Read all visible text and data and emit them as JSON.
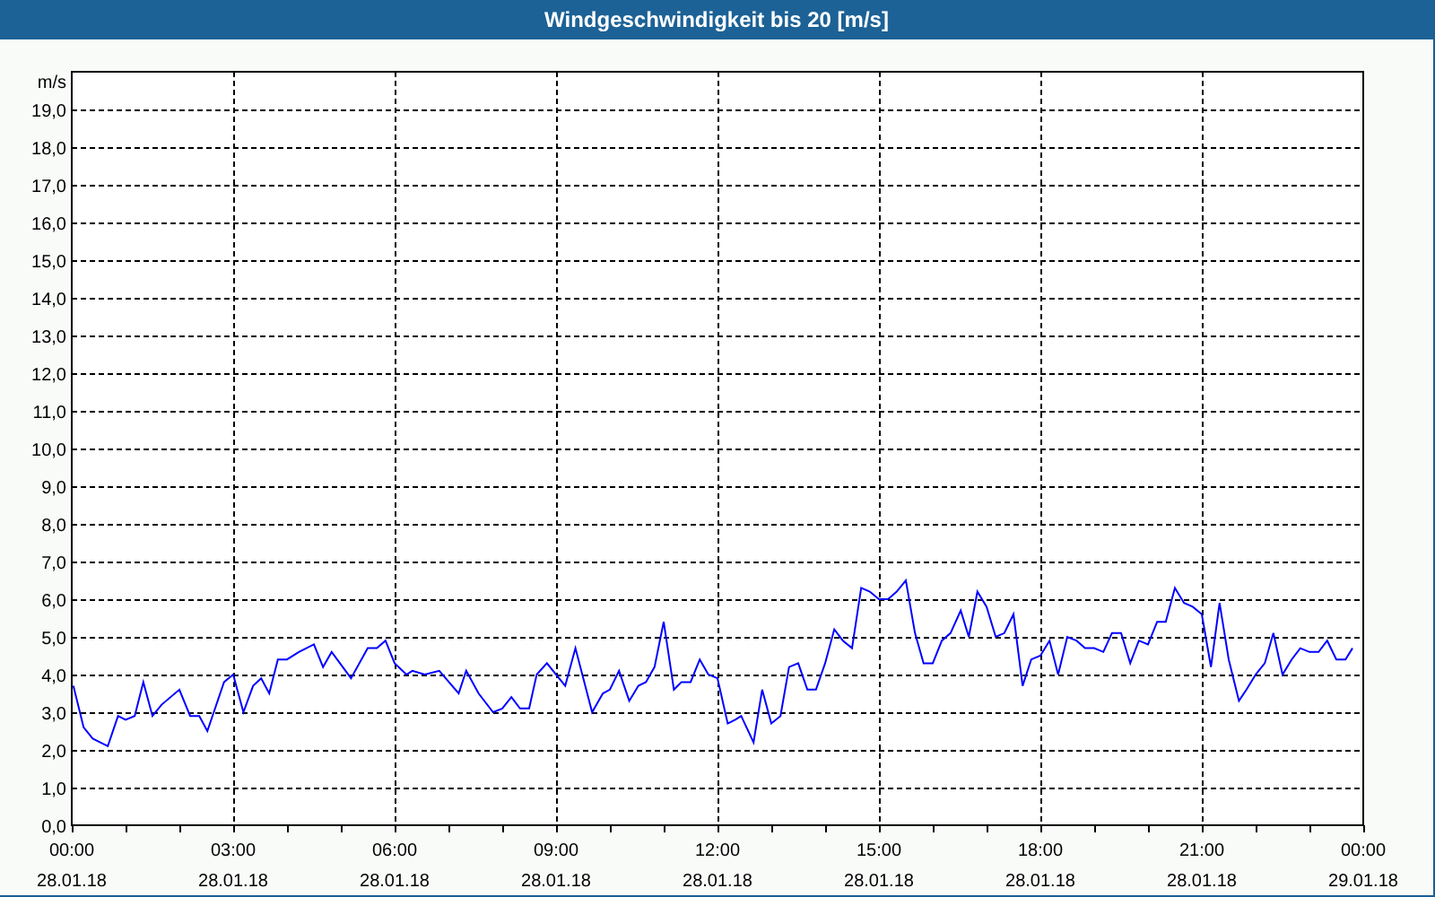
{
  "window": {
    "title": "Windgeschwindigkeit bis 20 [m/s]"
  },
  "chart": {
    "date_labels": [
      "28.01.18",
      "28.01.18",
      "28.01.18",
      "28.01.18",
      "28.01.18",
      "28.01.18",
      "28.01.18",
      "28.01.18",
      "29.01.18"
    ],
    "chart_data": {
      "type": "line",
      "ylabel": "m/s",
      "grid": true,
      "xlim": [
        0,
        24
      ],
      "ylim": [
        0,
        20
      ],
      "xticks": [
        {
          "value": 0,
          "label": "00:00"
        },
        {
          "value": 3,
          "label": "03:00"
        },
        {
          "value": 6,
          "label": "06:00"
        },
        {
          "value": 9,
          "label": "09:00"
        },
        {
          "value": 12,
          "label": "12:00"
        },
        {
          "value": 15,
          "label": "15:00"
        },
        {
          "value": 18,
          "label": "18:00"
        },
        {
          "value": 21,
          "label": "21:00"
        },
        {
          "value": 24,
          "label": "00:00"
        }
      ],
      "yticks": [
        {
          "value": 0,
          "label": "0,0"
        },
        {
          "value": 1,
          "label": "1,0"
        },
        {
          "value": 2,
          "label": "2,0"
        },
        {
          "value": 3,
          "label": "3,0"
        },
        {
          "value": 4,
          "label": "4,0"
        },
        {
          "value": 5,
          "label": "5,0"
        },
        {
          "value": 6,
          "label": "6,0"
        },
        {
          "value": 7,
          "label": "7,0"
        },
        {
          "value": 8,
          "label": "8,0"
        },
        {
          "value": 9,
          "label": "9,0"
        },
        {
          "value": 10,
          "label": "10,0"
        },
        {
          "value": 11,
          "label": "11,0"
        },
        {
          "value": 12,
          "label": "12,0"
        },
        {
          "value": 13,
          "label": "13,0"
        },
        {
          "value": 14,
          "label": "14,0"
        },
        {
          "value": 15,
          "label": "15,0"
        },
        {
          "value": 16,
          "label": "16,0"
        },
        {
          "value": 17,
          "label": "17,0"
        },
        {
          "value": 18,
          "label": "18,0"
        },
        {
          "value": 19,
          "label": "19,0"
        }
      ],
      "x": [
        0.03,
        0.22,
        0.39,
        0.67,
        0.86,
        1.0,
        1.17,
        1.33,
        1.5,
        1.67,
        2.0,
        2.2,
        2.37,
        2.52,
        2.83,
        3.0,
        3.19,
        3.37,
        3.52,
        3.67,
        3.83,
        4.0,
        4.22,
        4.5,
        4.67,
        4.83,
        5.19,
        5.5,
        5.67,
        5.83,
        6.0,
        6.22,
        6.33,
        6.56,
        6.83,
        7.19,
        7.33,
        7.56,
        7.83,
        8.0,
        8.17,
        8.33,
        8.5,
        8.64,
        8.83,
        9.0,
        9.17,
        9.36,
        9.67,
        9.87,
        10.0,
        10.17,
        10.36,
        10.53,
        10.67,
        10.83,
        11.0,
        11.19,
        11.33,
        11.5,
        11.67,
        11.83,
        12.0,
        12.19,
        12.33,
        12.44,
        12.67,
        12.83,
        13.0,
        13.17,
        13.33,
        13.5,
        13.67,
        13.83,
        14.0,
        14.17,
        14.33,
        14.5,
        14.67,
        14.83,
        15.0,
        15.17,
        15.33,
        15.5,
        15.67,
        15.83,
        16.0,
        16.17,
        16.33,
        16.52,
        16.67,
        16.83,
        17.0,
        17.17,
        17.33,
        17.5,
        17.67,
        17.83,
        18.0,
        18.17,
        18.33,
        18.5,
        18.67,
        18.83,
        19.0,
        19.17,
        19.33,
        19.5,
        19.67,
        19.83,
        20.0,
        20.17,
        20.33,
        20.5,
        20.67,
        20.83,
        21.0,
        21.17,
        21.33,
        21.5,
        21.69,
        21.83,
        22.0,
        22.17,
        22.33,
        22.5,
        22.67,
        22.83,
        23.0,
        23.17,
        23.33,
        23.5,
        23.67,
        23.8
      ],
      "series": [
        {
          "color": "#0000ff",
          "values": [
            3.7,
            2.6,
            2.3,
            2.1,
            2.9,
            2.8,
            2.9,
            3.8,
            2.9,
            3.2,
            3.6,
            2.9,
            2.9,
            2.5,
            3.8,
            4.0,
            3.0,
            3.7,
            3.9,
            3.5,
            4.4,
            4.4,
            4.6,
            4.8,
            4.2,
            4.6,
            3.9,
            4.7,
            4.7,
            4.9,
            4.3,
            4.0,
            4.1,
            4.0,
            4.1,
            3.5,
            4.1,
            3.5,
            3.0,
            3.1,
            3.4,
            3.1,
            3.1,
            4.0,
            4.3,
            4.0,
            3.7,
            4.7,
            3.0,
            3.5,
            3.6,
            4.1,
            3.3,
            3.7,
            3.8,
            4.2,
            5.4,
            3.6,
            3.8,
            3.8,
            4.4,
            4.0,
            3.9,
            2.7,
            2.8,
            2.9,
            2.2,
            3.6,
            2.7,
            2.9,
            4.2,
            4.3,
            3.6,
            3.6,
            4.3,
            5.2,
            4.9,
            4.7,
            6.3,
            6.2,
            6.0,
            6.0,
            6.2,
            6.5,
            5.1,
            4.3,
            4.3,
            4.9,
            5.1,
            5.7,
            5.0,
            6.2,
            5.8,
            5.0,
            5.1,
            5.6,
            3.7,
            4.4,
            4.5,
            4.9,
            4.0,
            5.0,
            4.9,
            4.7,
            4.7,
            4.6,
            5.1,
            5.1,
            4.3,
            4.9,
            4.8,
            5.4,
            5.4,
            6.3,
            5.9,
            5.8,
            5.6,
            4.2,
            5.9,
            4.4,
            3.3,
            3.6,
            4.0,
            4.3,
            5.1,
            4.0,
            4.4,
            4.7,
            4.6,
            4.6,
            4.9,
            4.4,
            4.4,
            4.7
          ]
        }
      ]
    }
  }
}
